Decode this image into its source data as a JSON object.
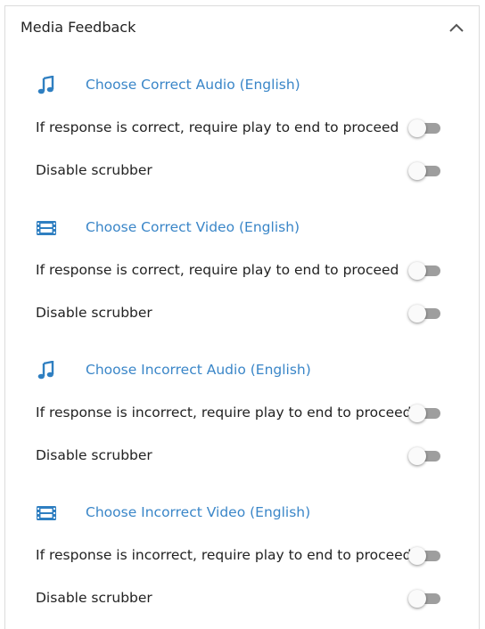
{
  "panel": {
    "title": "Media Feedback",
    "collapse_icon": "chevron-up-icon"
  },
  "colors": {
    "link": "#3a86c8",
    "toggle_track_off": "#9e9e9e"
  },
  "sections": [
    {
      "icon": "music-note-icon",
      "link": "Choose Correct Audio (English)",
      "require_play_label": "If response is correct, require play to end to proceed",
      "require_play_on": false,
      "scrubber_label": "Disable scrubber",
      "scrubber_on": false
    },
    {
      "icon": "film-icon",
      "link": "Choose Correct Video (English)",
      "require_play_label": "If response is correct, require play to end to proceed",
      "require_play_on": false,
      "scrubber_label": "Disable scrubber",
      "scrubber_on": false
    },
    {
      "icon": "music-note-icon",
      "link": "Choose Incorrect Audio (English)",
      "require_play_label": "If response is incorrect, require play to end to proceed",
      "require_play_on": false,
      "scrubber_label": "Disable scrubber",
      "scrubber_on": false
    },
    {
      "icon": "film-icon",
      "link": "Choose Incorrect Video (English)",
      "require_play_label": "If response is incorrect, require play to end to proceed",
      "require_play_on": false,
      "scrubber_label": "Disable scrubber",
      "scrubber_on": false
    }
  ]
}
